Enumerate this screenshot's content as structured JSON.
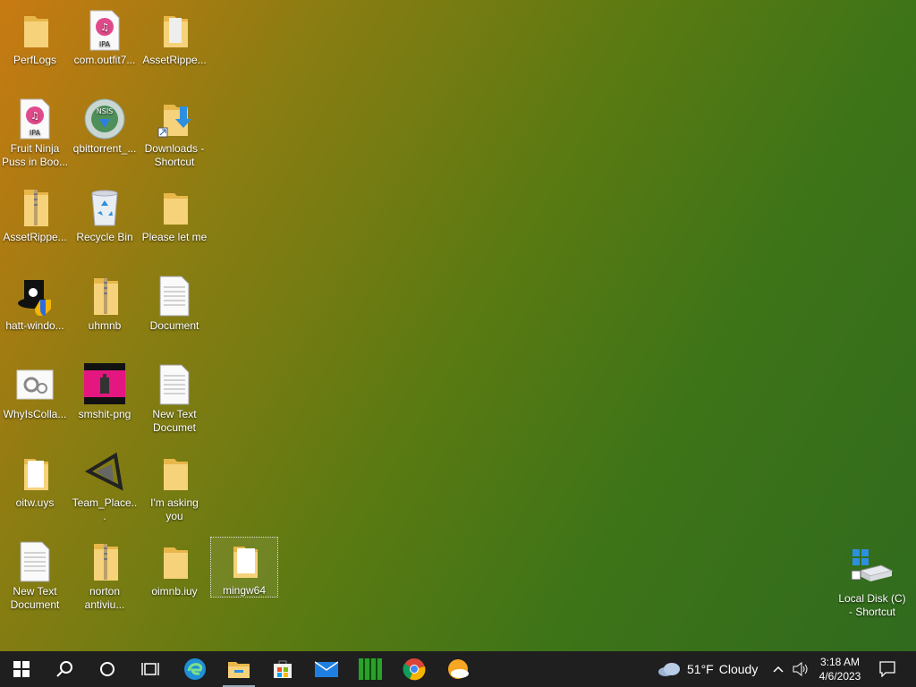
{
  "desktop": {
    "icons": [
      {
        "label": "PerfLogs"
      },
      {
        "label": "com.outfit7..."
      },
      {
        "label": "AssetRippe..."
      },
      {
        "label": "Fruit Ninja Puss in Boo..."
      },
      {
        "label": "qbittorrent_..."
      },
      {
        "label": "Downloads - Shortcut"
      },
      {
        "label": "AssetRippe..."
      },
      {
        "label": "Recycle Bin"
      },
      {
        "label": "‎Please let me"
      },
      {
        "label": "hatt-windo..."
      },
      {
        "label": "uhmnb"
      },
      {
        "label": "Document"
      },
      {
        "label": "WhyIsColla..."
      },
      {
        "label": "smshit-png"
      },
      {
        "label": "New Text Documet"
      },
      {
        "label": "oitw.uys"
      },
      {
        "label": "Team_Place..."
      },
      {
        "label": "I'm  asking you"
      },
      {
        "label": "New Text Document"
      },
      {
        "label": "norton antiviu..."
      },
      {
        "label": "oimnb.iuy"
      },
      {
        "label": "mingw64"
      },
      {
        "label": "Local Disk (C) - Shortcut"
      }
    ],
    "ipa_badge": "IPA",
    "nsis_badge": "NSIS"
  },
  "taskbar": {
    "weather": {
      "temp": "51°F",
      "condition": "Cloudy"
    },
    "clock": {
      "time": "3:18 AM",
      "date": "4/6/2023"
    }
  }
}
